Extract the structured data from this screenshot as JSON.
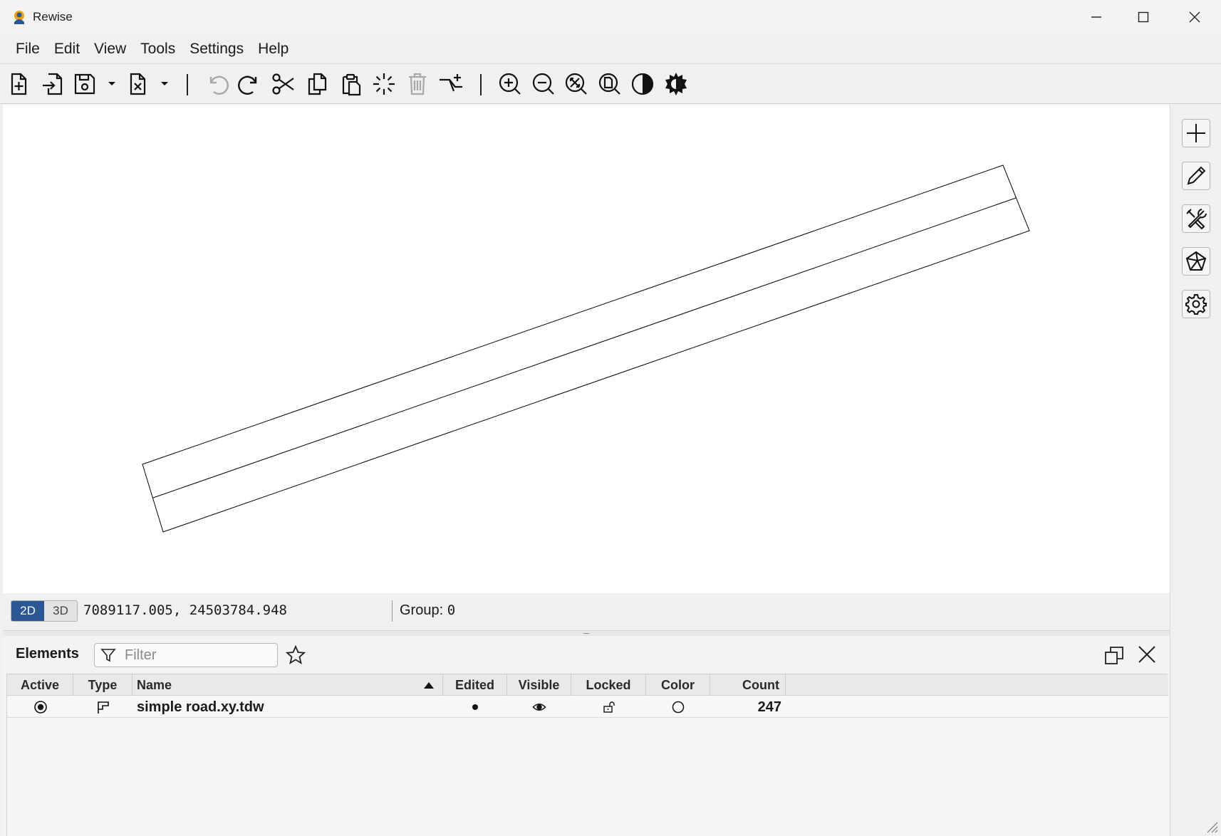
{
  "window": {
    "title": "Rewise",
    "app_icon": "rewise-logo-icon",
    "controls": [
      "minimize-icon",
      "maximize-icon",
      "close-icon"
    ]
  },
  "menu": [
    {
      "label": "File"
    },
    {
      "label": "Edit"
    },
    {
      "label": "View"
    },
    {
      "label": "Tools"
    },
    {
      "label": "Settings"
    },
    {
      "label": "Help"
    }
  ],
  "toolbar": {
    "icons": [
      "new-file-icon",
      "import-icon",
      "save-icon",
      "close-file-icon",
      "undo-icon",
      "redo-icon",
      "cut-icon",
      "copy-icon",
      "paste-icon",
      "select-icon",
      "delete-icon",
      "split-icon",
      "zoom-in-icon",
      "zoom-out-icon",
      "zoom-extents-icon",
      "zoom-page-icon",
      "contrast-icon",
      "brightness-icon"
    ],
    "disabled": [
      "undo-icon",
      "delete-icon"
    ]
  },
  "right_panel": {
    "icons": [
      "add-icon",
      "edit-pencil-icon",
      "tools-icon",
      "polygon-icon",
      "settings-gear-icon"
    ]
  },
  "status": {
    "mode_2d": "2D",
    "mode_3d": "3D",
    "active_mode": "2D",
    "coordinates": "7089117.005, 24503784.948",
    "group_label": "Group:",
    "group_value": "0",
    "accent_color": "#2b5797"
  },
  "elements_panel": {
    "title": "Elements",
    "filter_placeholder": "Filter",
    "columns": {
      "active": "Active",
      "type": "Type",
      "name": "Name",
      "edited": "Edited",
      "visible": "Visible",
      "locked": "Locked",
      "color": "Color",
      "count": "Count"
    },
    "sort": {
      "column": "Name",
      "direction": "ascending"
    },
    "rows": [
      {
        "active": true,
        "type_icon": "polyline-type-icon",
        "name": "simple road.xy.tdw",
        "edited": true,
        "visible": true,
        "locked": false,
        "color": "#ffffff",
        "count": "247"
      }
    ]
  }
}
